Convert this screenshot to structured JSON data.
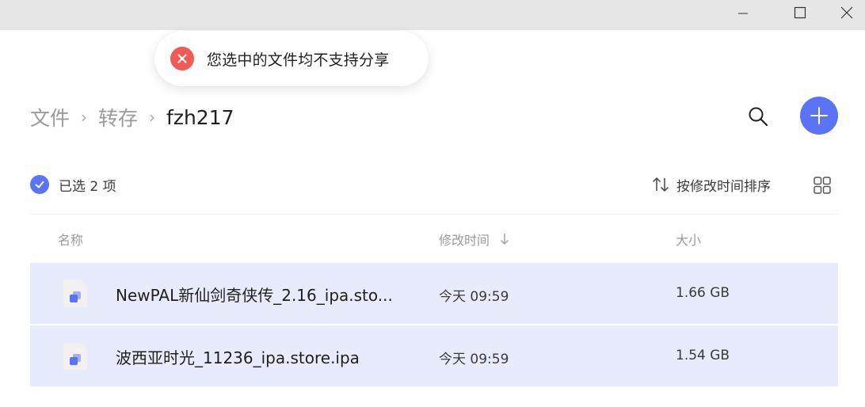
{
  "colors": {
    "accent": "#5b73f5",
    "selected_row": "#e8ebfc",
    "error": "#f25a55",
    "titlebar": "#e6e6e6"
  },
  "window": {
    "minimize_icon": "minimize-icon",
    "maximize_icon": "maximize-icon",
    "close_icon": "close-icon"
  },
  "toast": {
    "icon": "error-icon",
    "message": "您选中的文件均不支持分享"
  },
  "breadcrumb": {
    "items": [
      "文件",
      "转存"
    ],
    "separator": "›",
    "current": "fzh217"
  },
  "toolbar": {
    "search_icon": "search-icon",
    "add_icon": "plus-icon"
  },
  "selection": {
    "text": "已选 2 项"
  },
  "sort": {
    "label": "按修改时间排序",
    "icon": "sort-arrows-icon"
  },
  "view_toggle": {
    "icon": "grid-view-icon"
  },
  "columns": {
    "name": "名称",
    "modified": "修改时间",
    "size": "大小"
  },
  "files": [
    {
      "name": "NewPAL新仙剑奇侠传_2.16_ipa.sto...",
      "modified": "今天 09:59",
      "size": "1.66 GB",
      "icon": "ipa-file-icon",
      "selected": true
    },
    {
      "name": "波西亚时光_11236_ipa.store.ipa",
      "modified": "今天 09:59",
      "size": "1.54 GB",
      "icon": "ipa-file-icon",
      "selected": true
    }
  ]
}
